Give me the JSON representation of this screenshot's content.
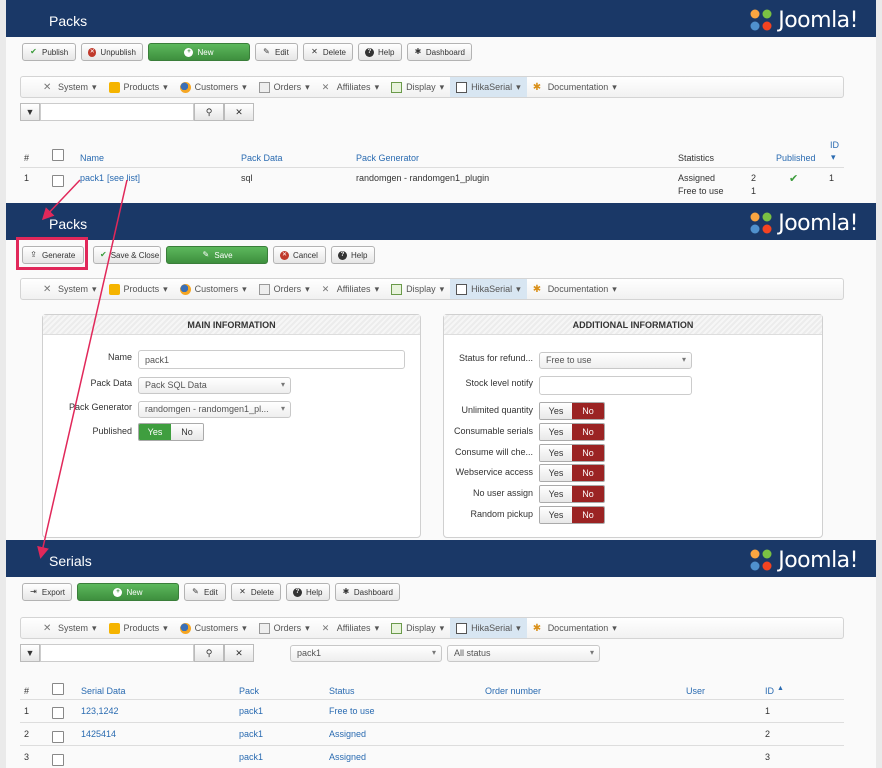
{
  "packs_list": {
    "title": "Packs",
    "logo_text": "Joomla!",
    "toolbar": {
      "publish": "Publish",
      "unpublish": "Unpublish",
      "new": "New",
      "edit": "Edit",
      "delete": "Delete",
      "help": "Help",
      "dashboard": "Dashboard"
    },
    "table": {
      "headers": {
        "num": "#",
        "name": "Name",
        "pack_data": "Pack Data",
        "pack_generator": "Pack Generator",
        "statistics": "Statistics",
        "published": "Published",
        "id": "ID"
      },
      "rows": [
        {
          "num": "1",
          "name": "pack1",
          "see_list": "[see list]",
          "pack_data": "sql",
          "pack_generator": "randomgen - randomgen1_plugin",
          "stat1_label": "Assigned",
          "stat1_value": "2",
          "stat2_label": "Free to use",
          "stat2_value": "1",
          "id": "1"
        }
      ]
    }
  },
  "menu": {
    "items": [
      "System",
      "Products",
      "Customers",
      "Orders",
      "Affiliates",
      "Display",
      "HikaSerial",
      "Documentation"
    ]
  },
  "pack_edit": {
    "title": "Packs",
    "logo_text": "Joomla!",
    "toolbar": {
      "generate": "Generate",
      "save_close": "Save & Close",
      "save": "Save",
      "cancel": "Cancel",
      "help": "Help"
    },
    "main_info": {
      "title": "MAIN INFORMATION",
      "name_label": "Name",
      "name_value": "pack1",
      "pack_data_label": "Pack Data",
      "pack_data_value": "Pack SQL Data",
      "pack_generator_label": "Pack Generator",
      "pack_generator_value": "randomgen - randomgen1_pl...",
      "published_label": "Published",
      "yes": "Yes",
      "no": "No"
    },
    "additional_info": {
      "title": "ADDITIONAL INFORMATION",
      "status_refund_label": "Status for refund...",
      "status_refund_value": "Free to use",
      "stock_label": "Stock level notify",
      "yes": "Yes",
      "no": "No",
      "toggles": [
        "Unlimited quantity",
        "Consumable serials",
        "Consume will che...",
        "Webservice access",
        "No user assign",
        "Random pickup"
      ]
    }
  },
  "serials_list": {
    "title": "Serials",
    "logo_text": "Joomla!",
    "toolbar": {
      "export": "Export",
      "new": "New",
      "edit": "Edit",
      "delete": "Delete",
      "help": "Help",
      "dashboard": "Dashboard"
    },
    "filters": {
      "pack": "pack1",
      "status": "All status"
    },
    "table": {
      "headers": {
        "num": "#",
        "serial_data": "Serial Data",
        "pack": "Pack",
        "status": "Status",
        "order_number": "Order number",
        "user": "User",
        "id": "ID"
      },
      "rows": [
        {
          "num": "1",
          "serial_data": "123,1242",
          "pack": "pack1",
          "status": "Free to use",
          "id": "1"
        },
        {
          "num": "2",
          "serial_data": "1425414",
          "pack": "pack1",
          "status": "Assigned",
          "id": "2"
        },
        {
          "num": "3",
          "serial_data": "",
          "pack": "pack1",
          "status": "Assigned",
          "id": "3"
        }
      ]
    }
  },
  "colors": {
    "header": "#1a3867",
    "link": "#2a6bb1",
    "green": "#3f9e3f",
    "red": "#9b2323",
    "highlight": "#e1285a"
  }
}
